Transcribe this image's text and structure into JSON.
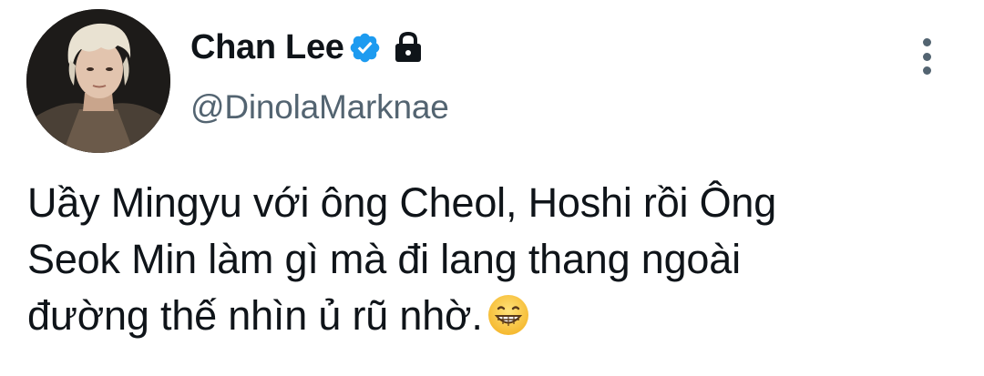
{
  "tweet": {
    "author": {
      "display_name": "Chan Lee",
      "handle": "@DinolaMarknae",
      "verified": true,
      "protected": true,
      "avatar_icon": "profile-photo"
    },
    "text_lines": [
      "Uầy Mingyu với ông Cheol, Hoshi rồi Ông",
      "Seok Min làm gì mà đi lang thang ngoài",
      "đường thế nhìn ủ rũ nhờ."
    ],
    "emoji": "grinning-face-with-smiling-eyes",
    "more_icon": "more-vertical-icon"
  },
  "colors": {
    "text_primary": "#0f1419",
    "text_secondary": "#536471",
    "verified_blue": "#1d9bf0"
  }
}
